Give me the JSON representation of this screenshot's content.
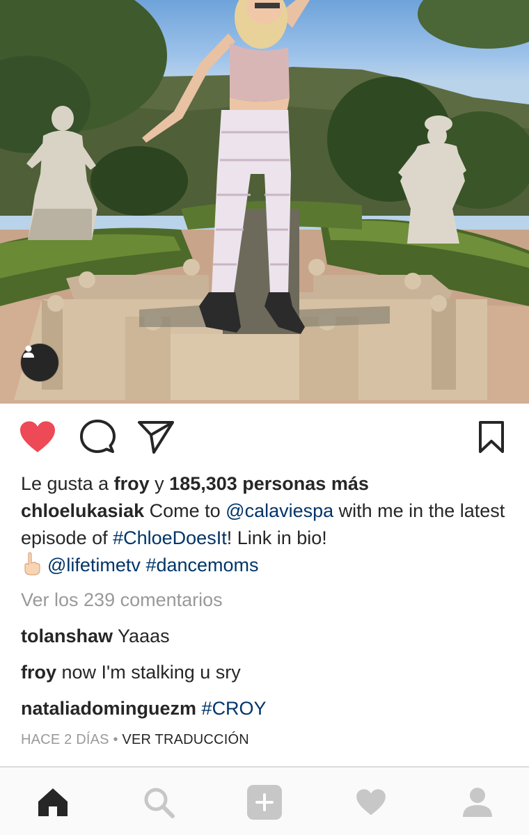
{
  "post": {
    "image": {
      "alt": ""
    }
  },
  "actions": {
    "like_state": "liked",
    "like_color": "#ed4956"
  },
  "likes": {
    "prefix": "Le gusta a",
    "user": "froy",
    "connector": "y",
    "count_text": "185,303 personas más"
  },
  "caption": {
    "username": "chloelukasiak",
    "text_1": " Come to ",
    "mention_1": "@calaviespa",
    "text_2": " with me in the latest episode of ",
    "hashtag_1": "#ChloeDoesIt",
    "text_3": "! Link in bio!",
    "emoji": "pointing-hand-emoji",
    "mention_2": "@lifetimetv",
    "hashtag_2": "#dancemoms"
  },
  "view_comments": "Ver los 239 comentarios",
  "comments": [
    {
      "username": "tolanshaw",
      "text": " Yaaas"
    },
    {
      "username": "froy",
      "text": " now I'm stalking u sry"
    },
    {
      "username": "nataliadominguezm",
      "text": " ",
      "hashtag": "#CROY"
    }
  ],
  "timestamp": {
    "time": "HACE 2 DÍAS",
    "separator": " • ",
    "translate": "VER TRADUCCIÓN"
  },
  "bottom_nav": {
    "items": [
      "home-icon",
      "search-icon",
      "add-post-icon",
      "activity-heart-icon",
      "profile-icon"
    ],
    "active": "home-icon"
  },
  "colors": {
    "link": "#003569",
    "muted": "#999999",
    "text": "#262626"
  }
}
